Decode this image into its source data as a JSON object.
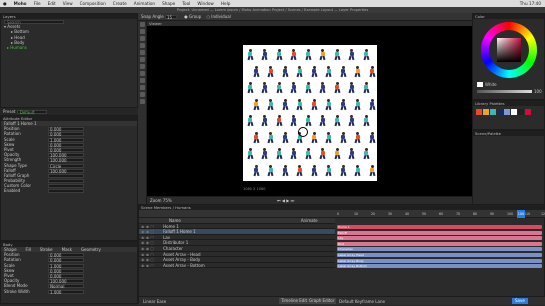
{
  "menubar": {
    "apple": "",
    "app": "Moho",
    "items": [
      "File",
      "Edit",
      "View",
      "Composition",
      "Create",
      "Animation",
      "Shape",
      "Tool",
      "Window",
      "Help"
    ],
    "clock": "Thu 17:40"
  },
  "titlebar": {
    "text": "Project: Unnamed — Lorem ipsum / Moho Animation Project / Scenes / Example Layout — Layer Properties"
  },
  "toolbar": {
    "snap_label": "Snap Angle",
    "snap_value": "15",
    "group_label": "Group",
    "individual_label": "Individual"
  },
  "left_top": {
    "header": "Layers",
    "search": "Search",
    "tree": [
      "Assets",
      "Bottom",
      "Head",
      "Body",
      "Humans"
    ]
  },
  "preset": {
    "label": "Preset",
    "value": "Default"
  },
  "attr": {
    "header": "Attribute Editor",
    "title": "Falloff 1 Home 1",
    "labels": [
      "Position",
      "Rotation",
      "Scale",
      "Skew",
      "Pivot",
      "Opacity",
      "Strength",
      "Shape Type",
      "Falloff",
      "Falloff Graph",
      "Probability",
      "Custom Color",
      "Enabled"
    ],
    "values": [
      "0.000",
      "0.000",
      "1.000",
      "0.000",
      "0.000",
      "100.000",
      "100.000",
      "Circle",
      "100.000",
      "",
      "",
      "",
      ""
    ]
  },
  "body": {
    "header": "Body",
    "tabs": [
      "Shape",
      "Fill",
      "Stroke",
      "Mask",
      "Geometry"
    ],
    "labels": [
      "Position",
      "Rotation",
      "Scale",
      "Skew",
      "Pivot",
      "Opacity",
      "Blend Mode",
      "Stroke Width"
    ],
    "values": [
      "0.000",
      "0.000",
      "1.000",
      "0.000",
      "0.000",
      "100.000",
      "Normal",
      "1.000"
    ]
  },
  "viewer": {
    "header": "Viewer",
    "footer": "Zoom 75%",
    "readout": "1080 X 1080"
  },
  "timeline": {
    "header": "Scene Members / Humans",
    "tabs": [
      "Name",
      "Animate",
      "Properties"
    ],
    "rows": [
      "Home 1",
      "Falloff 1 Home 1",
      "Lay",
      "Distributor 1",
      "Character",
      "Asset Array - Head",
      "Asset Array - Body",
      "Asset Array - Bottom"
    ],
    "bars": [
      "Home 1",
      "Falloff",
      "Lay",
      "Dist",
      "Character",
      "Label Array Head",
      "Label Array Body",
      "Label Array Bottom"
    ],
    "ticks": [
      "0",
      "10",
      "20",
      "30",
      "40",
      "50",
      "60",
      "70",
      "80",
      "90",
      "100",
      "110",
      "120"
    ],
    "frame": "100",
    "status": "Default Keyframe Lane",
    "footer_left": "Linear Ease",
    "footer_btn": "Timeline Editor",
    "footer_btn2": "Graph Editor",
    "save": "Save"
  },
  "right": {
    "color_header": "Color",
    "hex": "White",
    "library_header": "Library Palettes",
    "scene_header": "Scene/Palette",
    "alpha": "100"
  },
  "colors": {
    "accent": "#2a7de1",
    "figure_palette": [
      "#1d2a55",
      "#3bb8b0",
      "#e84a2c",
      "#f0a12b",
      "#7a9bd0",
      "#2e3a8c"
    ]
  }
}
